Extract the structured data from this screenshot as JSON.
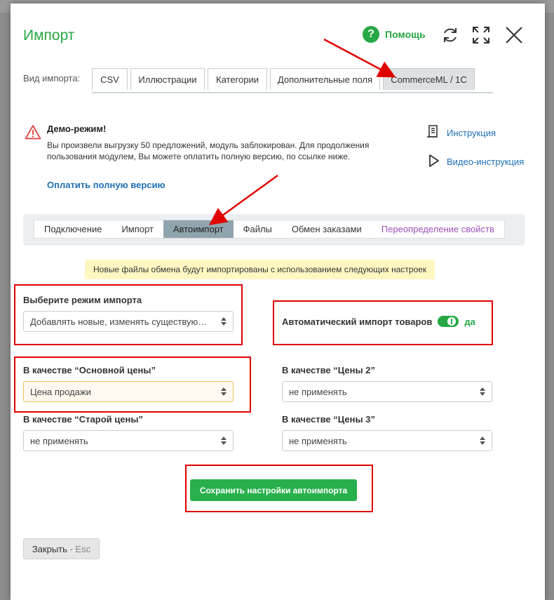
{
  "modal": {
    "title": "Импорт",
    "help_label": "Помощь"
  },
  "import_type": {
    "label": "Вид импорта:",
    "tabs": [
      "CSV",
      "Иллюстрации",
      "Категории",
      "Дополнительные поля",
      "CommerceML / 1C"
    ],
    "active_tab": "CommerceML / 1C"
  },
  "demo": {
    "title": "Демо-режим!",
    "text": "Вы произвели выгрузку 50 предложений, модуль заблокирован. Для продолжения пользования модулем, Вы можете оплатить полную версию, по ссылке ниже.",
    "pay_link": "Оплатить полную версию"
  },
  "docs": {
    "instruction": "Инструкция",
    "video": "Видео-инструкция"
  },
  "subtabs": {
    "items": [
      "Подключение",
      "Импорт",
      "Автоимпорт",
      "Файлы",
      "Обмен заказами",
      "Переопределение свойств"
    ],
    "active": "Автоимпорт"
  },
  "notice": "Новые файлы обмена будут импортированы с использованием следующих настроек",
  "fields": {
    "mode": {
      "label": "Выберите режим импорта",
      "value": "Добавлять новые, изменять существующие"
    },
    "auto_import": {
      "label": "Автоматический импорт товаров",
      "value": "да",
      "enabled": true
    },
    "base_price": {
      "label": "В качестве “Основной цены”",
      "value": "Цена продажи"
    },
    "price2": {
      "label": "В качестве “Цены 2”",
      "value": "не применять"
    },
    "old_price": {
      "label": "В качестве “Старой цены”",
      "value": "не применять"
    },
    "price3": {
      "label": "В качестве “Цены 3”",
      "value": "не применять"
    }
  },
  "buttons": {
    "save": "Сохранить настройки автоимпорта",
    "close": "Закрыть",
    "close_hint": "- Esc"
  },
  "colors": {
    "accent_green": "#27a844",
    "link_blue": "#1e6fb5",
    "annotation_red": "#e00000"
  }
}
